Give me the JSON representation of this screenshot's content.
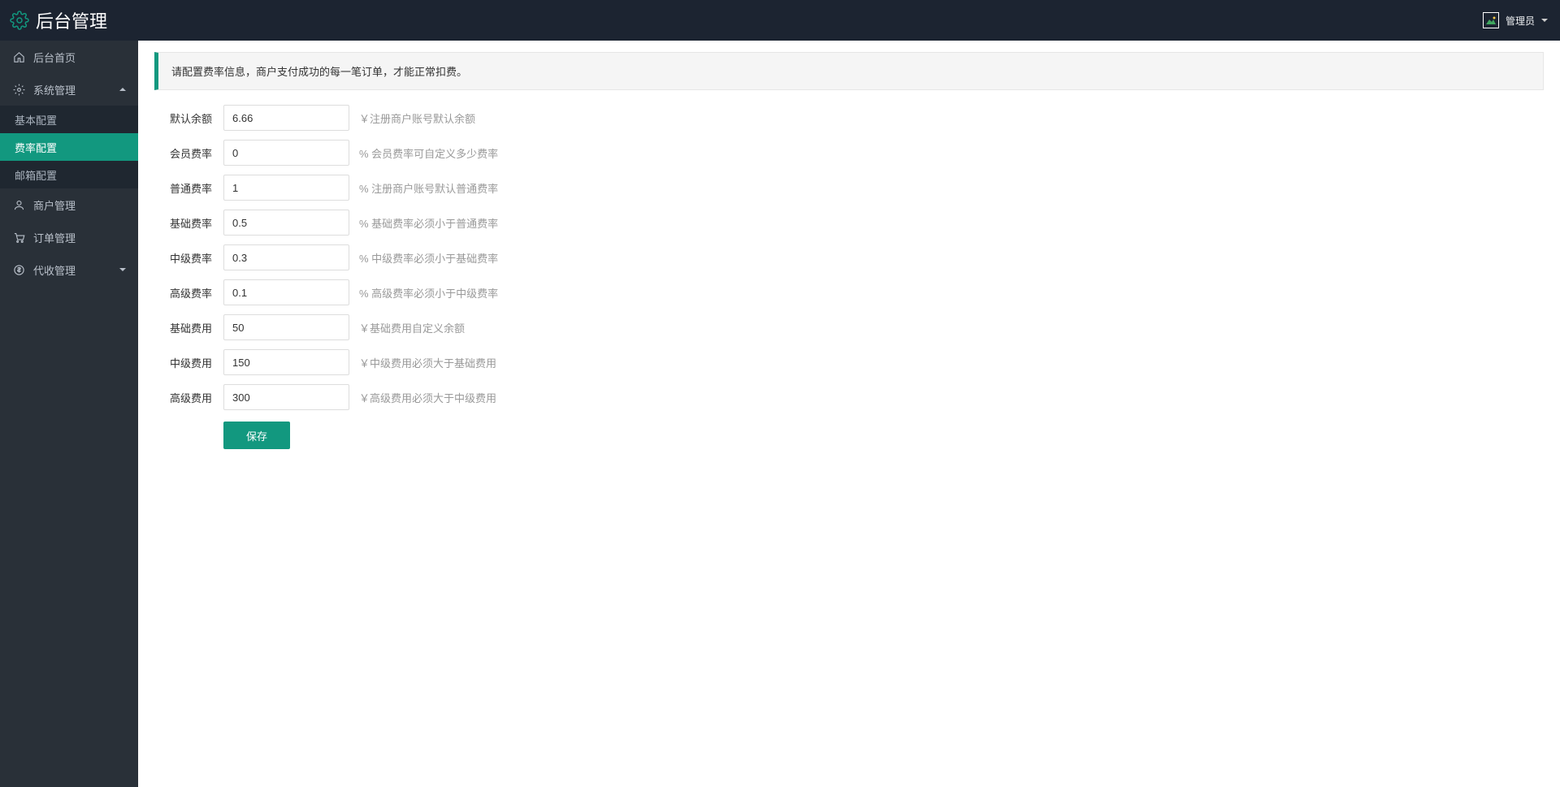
{
  "brand": "后台管理",
  "user": {
    "name": "管理员"
  },
  "sidebar": {
    "items": [
      {
        "icon": "home",
        "label": "后台首页"
      },
      {
        "icon": "gear",
        "label": "系统管理",
        "expanded": true
      },
      {
        "icon": "user",
        "label": "商户管理"
      },
      {
        "icon": "cart",
        "label": "订单管理"
      },
      {
        "icon": "dollar",
        "label": "代收管理",
        "hasChildren": true
      }
    ],
    "system_submenu": [
      {
        "label": "基本配置"
      },
      {
        "label": "费率配置",
        "active": true
      },
      {
        "label": "邮箱配置"
      }
    ]
  },
  "alert": "请配置费率信息，商户支付成功的每一笔订单，才能正常扣费。",
  "form": {
    "fields": [
      {
        "key": "default_balance",
        "label": "默认余额",
        "value": "6.66",
        "hint": "￥注册商户账号默认余额"
      },
      {
        "key": "member_rate",
        "label": "会员费率",
        "value": "0",
        "hint": "% 会员费率可自定义多少费率"
      },
      {
        "key": "normal_rate",
        "label": "普通费率",
        "value": "1",
        "hint": "% 注册商户账号默认普通费率"
      },
      {
        "key": "base_rate",
        "label": "基础费率",
        "value": "0.5",
        "hint": "% 基础费率必须小于普通费率"
      },
      {
        "key": "mid_rate",
        "label": "中级费率",
        "value": "0.3",
        "hint": "% 中级费率必须小于基础费率"
      },
      {
        "key": "high_rate",
        "label": "高级费率",
        "value": "0.1",
        "hint": "% 高级费率必须小于中级费率"
      },
      {
        "key": "base_fee",
        "label": "基础费用",
        "value": "50",
        "hint": "￥基础费用自定义余额"
      },
      {
        "key": "mid_fee",
        "label": "中级费用",
        "value": "150",
        "hint": "￥中级费用必须大于基础费用"
      },
      {
        "key": "high_fee",
        "label": "高级费用",
        "value": "300",
        "hint": "￥高级费用必须大于中级费用"
      }
    ],
    "submit_label": "保存"
  }
}
